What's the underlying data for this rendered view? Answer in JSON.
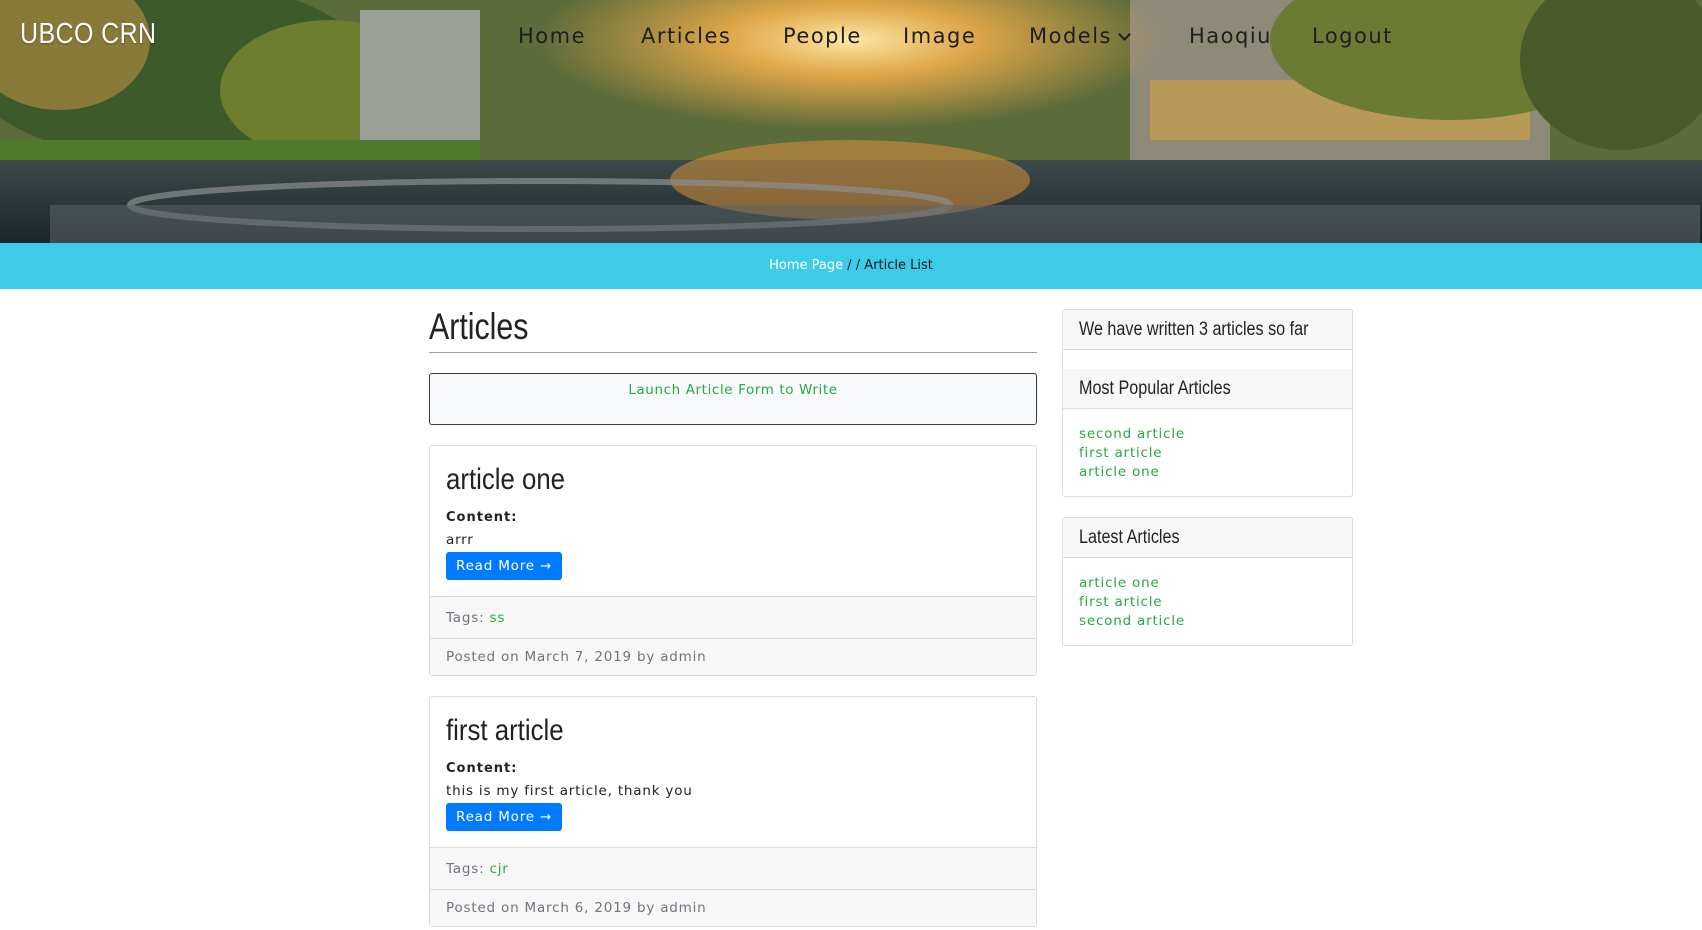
{
  "brand": "UBCO CRN",
  "nav": {
    "home": "Home",
    "articles": "Articles",
    "people": "People",
    "image": "Image",
    "models": "Models",
    "user": "Haoqiu",
    "logout": "Logout"
  },
  "breadcrumb": {
    "home": "Home Page",
    "separator": " / / ",
    "current": "Article List"
  },
  "main": {
    "title": "Articles",
    "launch_label": "Launch Article Form to Write",
    "articles": [
      {
        "title": "article one",
        "content_label": "Content:",
        "content": "arrr",
        "read_more": "Read More →",
        "tags_label": "Tags:",
        "tag": "ss",
        "posted": "Posted on March 7, 2019 by admin"
      },
      {
        "title": "first article",
        "content_label": "Content:",
        "content": "this is my first article, thank you",
        "read_more": "Read More →",
        "tags_label": "Tags:",
        "tag": "cjr",
        "posted": "Posted on March 6, 2019 by admin"
      }
    ]
  },
  "sidebar": {
    "count_text": "We have written 3 articles so far",
    "popular_title": "Most Popular Articles",
    "popular": [
      "second article",
      "first article",
      "article one"
    ],
    "latest_title": "Latest Articles",
    "latest": [
      "article one",
      "first article",
      "second article"
    ]
  },
  "colors": {
    "accent_bar": "#3ecbe8",
    "link_green": "#28a745",
    "button_blue": "#007bff"
  },
  "icons": {
    "models_dropdown": "chevron-down-icon"
  }
}
